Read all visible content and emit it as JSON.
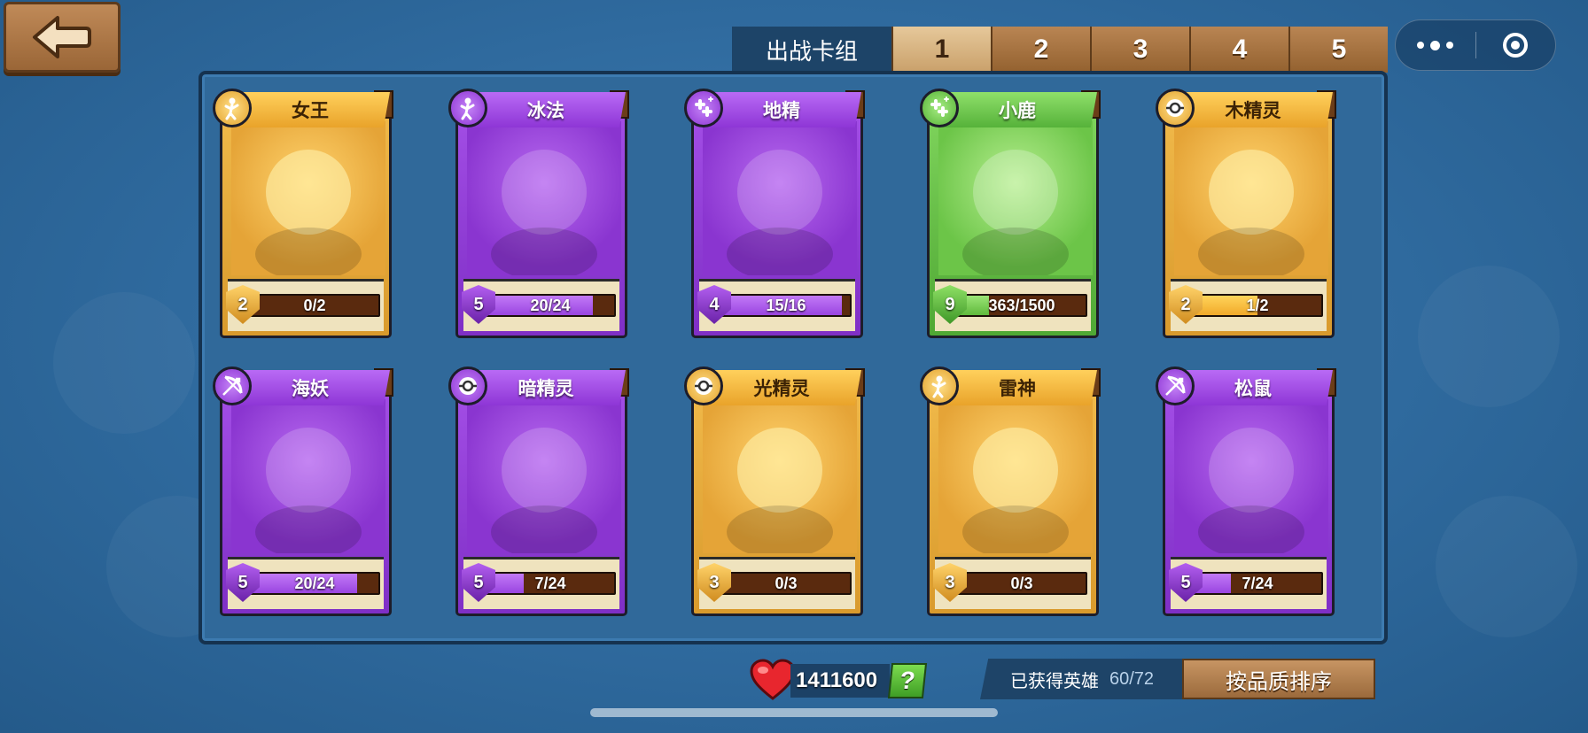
{
  "header": {
    "deck_label": "出战卡组",
    "deck_tabs": [
      "1",
      "2",
      "3",
      "4",
      "5"
    ],
    "active_tab": "1"
  },
  "cards": [
    {
      "name": "女王",
      "rarity": "gold",
      "role": "melee-icon",
      "level": "2",
      "progress": "0/2",
      "fill": 0.0
    },
    {
      "name": "冰法",
      "rarity": "purple",
      "role": "melee-icon",
      "level": "5",
      "progress": "20/24",
      "fill": 0.83
    },
    {
      "name": "地精",
      "rarity": "purple",
      "role": "support-icon",
      "level": "4",
      "progress": "15/16",
      "fill": 0.94
    },
    {
      "name": "小鹿",
      "rarity": "green",
      "role": "support-icon",
      "level": "9",
      "progress": "363/1500",
      "fill": 0.24
    },
    {
      "name": "木精灵",
      "rarity": "gold",
      "role": "orb-icon",
      "level": "2",
      "progress": "1/2",
      "fill": 0.5
    },
    {
      "name": "海妖",
      "rarity": "purple",
      "role": "ranged-icon",
      "level": "5",
      "progress": "20/24",
      "fill": 0.83
    },
    {
      "name": "暗精灵",
      "rarity": "purple",
      "role": "orb-icon",
      "level": "5",
      "progress": "7/24",
      "fill": 0.29
    },
    {
      "name": "光精灵",
      "rarity": "gold",
      "role": "orb-icon",
      "level": "3",
      "progress": "0/3",
      "fill": 0.0
    },
    {
      "name": "雷神",
      "rarity": "gold",
      "role": "melee-icon",
      "level": "3",
      "progress": "0/3",
      "fill": 0.0
    },
    {
      "name": "松鼠",
      "rarity": "purple",
      "role": "ranged-icon",
      "level": "5",
      "progress": "7/24",
      "fill": 0.29
    }
  ],
  "footer": {
    "hearts": "1411600",
    "help_label": "?",
    "obtained_label": "已获得英雄",
    "obtained_count": "60/72",
    "sort_label": "按品质排序"
  },
  "colors": {
    "gold": "#f0b94a",
    "purple": "#a34ee6",
    "green": "#7fd45c",
    "background": "#2f6a9e"
  }
}
